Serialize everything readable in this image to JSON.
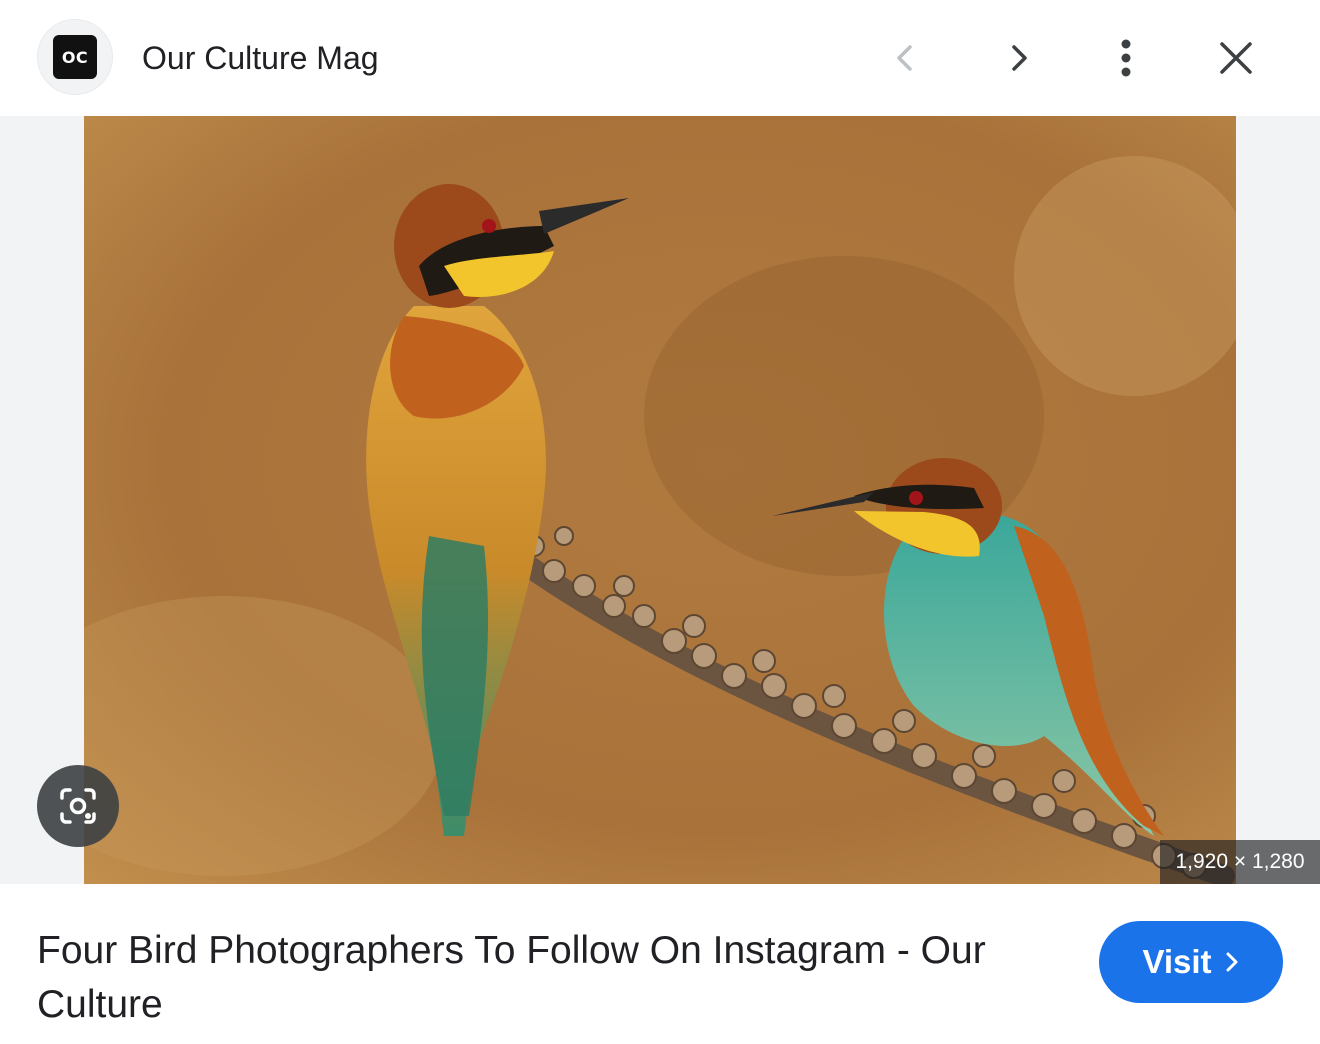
{
  "header": {
    "favicon_text": "OC",
    "site_name": "Our Culture Mag"
  },
  "image": {
    "alt": "Two bee-eaters perched on a branch",
    "dimensions": "1,920 × 1,280"
  },
  "result": {
    "title": "Four Bird Photographers To Follow On Instagram - Our Culture",
    "visit_label": "Visit"
  },
  "colors": {
    "accent": "#1a73e8",
    "icon": "#5f6368",
    "icon_disabled": "#bdc1c6"
  },
  "icons": [
    "chevron-left-icon",
    "chevron-right-icon",
    "more-vert-icon",
    "close-icon",
    "lens-icon",
    "chevron-right-icon"
  ]
}
